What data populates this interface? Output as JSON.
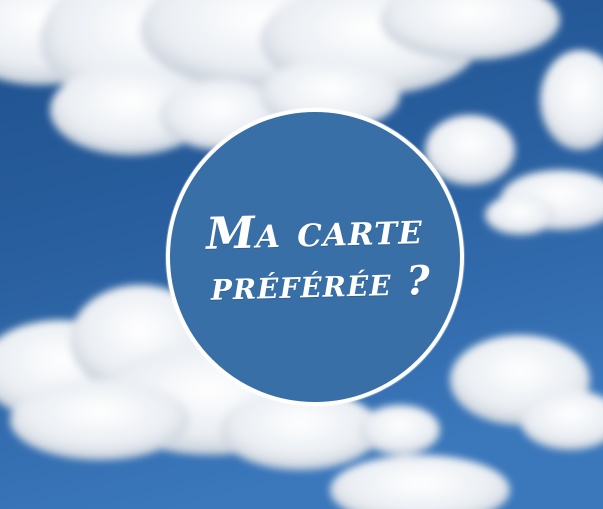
{
  "image": {
    "background": "sky-with-clouds",
    "colors": {
      "sky_dark": "#1d4f8c",
      "sky_mid": "#2e66a6",
      "sky_light": "#5b8fcf",
      "cloud": "#f2f4f7",
      "badge_fill": "#386fa7",
      "badge_border": "#ffffff",
      "text": "#ffffff"
    }
  },
  "badge": {
    "line1": "Ma carte",
    "line2": "préférée ?"
  }
}
